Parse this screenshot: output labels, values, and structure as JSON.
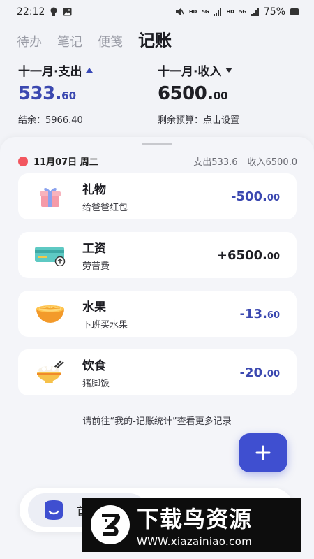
{
  "status_bar": {
    "time": "22:12",
    "network_labels": [
      "HD",
      "5G",
      "HD",
      "5G"
    ],
    "battery": "75%",
    "icons": [
      "bulb-icon",
      "image-icon",
      "mute-icon",
      "signal-icon",
      "battery-icon"
    ]
  },
  "nav": {
    "tabs": [
      {
        "label": "待办"
      },
      {
        "label": "笔记"
      },
      {
        "label": "便笺"
      },
      {
        "label": "记账"
      }
    ],
    "active": "记账"
  },
  "summary": {
    "expense": {
      "heading": "十一月·支出",
      "int": "533.",
      "dec": "60",
      "sub": "结余：5966.40"
    },
    "income": {
      "heading": "十一月·收入",
      "int": "6500.",
      "dec": "00",
      "sub": "剩余预算：点击设置"
    },
    "colors": {
      "expense": "#3b48b0",
      "income": "#1e1e24"
    }
  },
  "day": {
    "date": "11月07日 周二",
    "expense_total": "支出533.6",
    "income_total": "收入6500.0"
  },
  "records": [
    {
      "title": "礼物",
      "note": "给爸爸红包",
      "int": "-500.",
      "dec": "00",
      "icon": "gift-icon",
      "color": "#3b48b0"
    },
    {
      "title": "工资",
      "note": "劳苦费",
      "int": "+6500.",
      "dec": "00",
      "icon": "salary-card-icon",
      "color": "#1e1e24"
    },
    {
      "title": "水果",
      "note": "下班买水果",
      "int": "-13.",
      "dec": "60",
      "icon": "orange-icon",
      "color": "#3b48b0"
    },
    {
      "title": "饮食",
      "note": "猪脚饭",
      "int": "-20.",
      "dec": "00",
      "icon": "rice-bowl-icon",
      "color": "#3b48b0"
    }
  ],
  "hint": "请前往“我的-记账统计”查看更多记录",
  "fab": {
    "icon": "plus-icon"
  },
  "bottom_bar": {
    "label": "首"
  },
  "watermark": {
    "brand": "下载鸟资源",
    "url": "WWW.xiazainiao.com"
  }
}
